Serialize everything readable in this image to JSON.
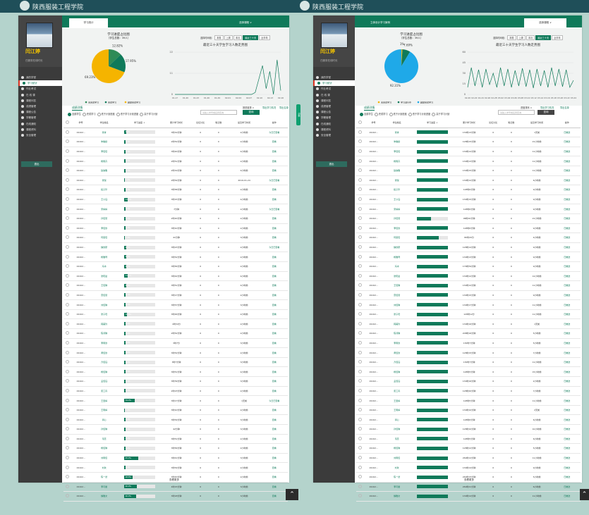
{
  "top_title": "陕西服装工程学院",
  "left": {
    "user_name": "闫江婷",
    "user_sub": "已服务在线时长",
    "menu": [
      "我的学堂",
      "学习统计",
      "作业考试",
      "在 线 课",
      "课程问答",
      "成绩管理",
      "课程公告",
      "学籍管理",
      "在线通知",
      "课程资料",
      "安全管理"
    ],
    "sidebar_button": "退出",
    "tab_active": "学习统计",
    "tab_dropdown": "选择课程 ∨",
    "pie_title": "学习进度占比图",
    "pie_sub": "（学生总数：39人）",
    "pie_labels": [
      "12.82%",
      "17.95%",
      "69.23%"
    ],
    "pie_legend": [
      "未完成学习",
      "完成学习",
      "超额完成学习"
    ],
    "filter_label": "选择时间段：",
    "filter_buttons": [
      "本周",
      "上周",
      "本月",
      "最近三十天",
      "近半年"
    ],
    "line_title": "最近三十天学生学习人数走势图",
    "y_ticks": [
      "22",
      "11",
      "0"
    ],
    "x_ticks": [
      "01-17",
      "01-20",
      "01-23",
      "01-26",
      "01-29",
      "02-01",
      "02-04",
      "02-07",
      "02-10",
      "02-13",
      "02-16"
    ],
    "section_title": "成绩详情",
    "sort_label": "按进度排 ∨",
    "export1": "导出学习情况",
    "export2": "导出名单",
    "radios": [
      "全部学生",
      "完成学习",
      "低于计划进度",
      "低于学习计划进度",
      "高于学习计划"
    ],
    "search_placeholder": "请输入学号或名称查询",
    "query_btn": "查询",
    "headers": [
      "学号",
      "学生姓名",
      "学习进度 ↓",
      "累计学习时长",
      "论坛讨论",
      "笔记数",
      "最近学习时间",
      "操作"
    ],
    "more": "查看更多"
  },
  "right": {
    "top_title": "陕西服装工程学院",
    "tab_active": "立体设计学习案例",
    "tab_dropdown": "选择课程 ∨",
    "pie_title": "学习进度占比图",
    "pie_sub": "（学生总数：39人）",
    "pie_labels": [
      "1%",
      "7.69%",
      "92.31%"
    ],
    "pie_legend": [
      "未完成学习",
      "学习进行中",
      "超额完成学习"
    ],
    "filter_label": "选择时间段：",
    "filter_buttons": [
      "本周",
      "上周",
      "本月",
      "最近三十天",
      "近半年"
    ],
    "line_title": "最近三十天学生学习人数走势图",
    "y_ticks": [
      "60",
      "45",
      "30",
      "15",
      "0"
    ],
    "x_ticks": [
      "02-20",
      "02-22",
      "02-24",
      "02-26",
      "02-28",
      "03-02",
      "03-04",
      "03-06",
      "03-08",
      "03-10",
      "03-12",
      "03-14",
      "03-16",
      "03-18",
      "03-20",
      "03-22",
      "03-24"
    ],
    "section_title": "成绩详情",
    "sort_label": "进度排序 ∨",
    "export1": "导出学习情况",
    "export2": "导出名单",
    "radios": [
      "全部学生",
      "完成学习",
      "低于计划进度",
      "低于学习计划进度",
      "高于学习计划"
    ],
    "search_placeholder": "请输入学号或名称查询",
    "query_btn": "查询",
    "headers": [
      "学号",
      "学生姓名",
      "学习进度 ↓",
      "累计学习时长",
      "论坛讨论",
      "笔记数",
      "最近学习时间",
      "操作"
    ],
    "more": "查看更多"
  },
  "left_rows": [
    {
      "id": "19102...",
      "name": "张青",
      "pct": "6.8%",
      "p": 0.068,
      "time": "3时19分钟",
      "f": "0",
      "n": "0",
      "last": "2小时前",
      "op": "今日已查看"
    },
    {
      "id": "19102...",
      "name": "朱敏婕",
      "pct": "4.4%",
      "p": 0.044,
      "time": "2时52分钟",
      "f": "0",
      "n": "0",
      "last": "2小时前",
      "op": "查看"
    },
    {
      "id": "19102...",
      "name": "李佳佳",
      "pct": "4.4%",
      "p": 0.044,
      "time": "3时20分钟",
      "f": "0",
      "n": "0",
      "last": "4小时前",
      "op": "查看"
    },
    {
      "id": "19102...",
      "name": "杨雨卉",
      "pct": "5.0%",
      "p": 0.05,
      "time": "2时51分钟",
      "f": "0",
      "n": "0",
      "last": "2小时前",
      "op": "查看"
    },
    {
      "id": "19102...",
      "name": "赵静雅",
      "pct": "4.3%",
      "p": 0.043,
      "time": "2时19分钟",
      "f": "0",
      "n": "0",
      "last": "4小时前",
      "op": "查看"
    },
    {
      "id": "19102...",
      "name": "张悦",
      "pct": "3.3%",
      "p": 0.033,
      "time": "2时54分钟",
      "f": "0",
      "n": "0",
      "last": "2019-01-24",
      "op": "今日已查看"
    },
    {
      "id": "19102...",
      "name": "段子珍",
      "pct": "5.3%",
      "p": 0.053,
      "time": "3时58分钟",
      "f": "0",
      "n": "0",
      "last": "2小时前",
      "op": "查看"
    },
    {
      "id": "19102...",
      "name": "王小钰",
      "pct": "12.2%",
      "p": 0.122,
      "time": "3时15分钟",
      "f": "0",
      "n": "0",
      "last": "4小时前",
      "op": "查看"
    },
    {
      "id": "19102...",
      "name": "宋婷婷",
      "pct": "5.3%",
      "p": 0.053,
      "time": "7分钟",
      "f": "0",
      "n": "0",
      "last": "2小时前",
      "op": "今日已查看"
    },
    {
      "id": "19102...",
      "name": "孙佳慧",
      "pct": "4.5%",
      "p": 0.045,
      "time": "2时20分钟",
      "f": "0",
      "n": "0",
      "last": "2小时前",
      "op": "查看"
    },
    {
      "id": "19102...",
      "name": "李佳欣",
      "pct": "4.3%",
      "p": 0.043,
      "time": "3时10分钟",
      "f": "0",
      "n": "0",
      "last": "2小时前",
      "op": "查看"
    },
    {
      "id": "19102...",
      "name": "何思佳",
      "pct": "3.4%",
      "p": 0.034,
      "time": "41分钟",
      "f": "0",
      "n": "0",
      "last": "3小时前",
      "op": "查看"
    },
    {
      "id": "19102...",
      "name": "魏欣研",
      "pct": "6.3%",
      "p": 0.063,
      "time": "3时23分钟",
      "f": "0",
      "n": "0",
      "last": "2小时前",
      "op": "今日已查看"
    },
    {
      "id": "19102...",
      "name": "杨雅琦",
      "pct": "6.3%",
      "p": 0.063,
      "time": "3时52分钟",
      "f": "0",
      "n": "0",
      "last": "2小时前",
      "op": "查看"
    },
    {
      "id": "19102...",
      "name": "冯冰",
      "pct": "6.7%",
      "p": 0.067,
      "time": "3时56分钟",
      "f": "0",
      "n": "0",
      "last": "2小时前",
      "op": "查看"
    },
    {
      "id": "19102...",
      "name": "张晓晨",
      "pct": "11.1%",
      "p": 0.111,
      "time": "3时42分钟",
      "f": "0",
      "n": "0",
      "last": "4小时前",
      "op": "查看"
    },
    {
      "id": "19102...",
      "name": "王佳琪",
      "pct": "8.3%",
      "p": 0.083,
      "time": "3时51分钟",
      "f": "0",
      "n": "0",
      "last": "4小时前",
      "op": "查看"
    },
    {
      "id": "19102...",
      "name": "雷佳慧",
      "pct": "5.1%",
      "p": 0.051,
      "time": "3时17分钟",
      "f": "0",
      "n": "0",
      "last": "2小时前",
      "op": "查看"
    },
    {
      "id": "19102...",
      "name": "刘佳琪",
      "pct": "4.4%",
      "p": 0.044,
      "time": "3时57分钟",
      "f": "0",
      "n": "0",
      "last": "3小时前",
      "op": "查看"
    },
    {
      "id": "19102...",
      "name": "张子旺",
      "pct": "10.0%",
      "p": 0.1,
      "time": "3时46分钟",
      "f": "0",
      "n": "0",
      "last": "2小时前",
      "op": "查看"
    },
    {
      "id": "19102...",
      "name": "韩美玲",
      "pct": "4.4%",
      "p": 0.044,
      "time": "4时34分",
      "f": "0",
      "n": "0",
      "last": "2小时前",
      "op": "查看"
    },
    {
      "id": "19102...",
      "name": "陈诗琪",
      "pct": "5.9%",
      "p": 0.059,
      "time": "2时52分钟",
      "f": "0",
      "n": "0",
      "last": "2小时前",
      "op": "查看"
    },
    {
      "id": "19102...",
      "name": "李雨欣",
      "pct": "4.9%",
      "p": 0.049,
      "time": "3时7分",
      "f": "0",
      "n": "0",
      "last": "3小时前",
      "op": "查看"
    },
    {
      "id": "19102...",
      "name": "黄佳欣",
      "pct": "5.8%",
      "p": 0.058,
      "time": "3时52分钟",
      "f": "0",
      "n": "0",
      "last": "2小时前",
      "op": "查看"
    },
    {
      "id": "19102...",
      "name": "齐佳钰",
      "pct": "6.0%",
      "p": 0.06,
      "time": "3时7分钟",
      "f": "0",
      "n": "0",
      "last": "3小时前",
      "op": "查看"
    },
    {
      "id": "19102...",
      "name": "杨佳琪",
      "pct": "4.5%",
      "p": 0.045,
      "time": "3时51分钟",
      "f": "0",
      "n": "0",
      "last": "4小时前",
      "op": "查看"
    },
    {
      "id": "19102...",
      "name": "孟佳钰",
      "pct": "4.4%",
      "p": 0.044,
      "time": "3时39分钟",
      "f": "0",
      "n": "0",
      "last": "3小时前",
      "op": "查看"
    },
    {
      "id": "19102...",
      "name": "唐工丹",
      "pct": "4.4%",
      "p": 0.044,
      "time": "2时23分钟",
      "f": "0",
      "n": "0",
      "last": "2小时前",
      "op": "查看"
    },
    {
      "id": "19102...",
      "name": "王雯婷",
      "pct": "34.0%",
      "p": 0.34,
      "time": "3时17分钟",
      "f": "0",
      "n": "0",
      "last": "1天前",
      "op": "今日已查看"
    },
    {
      "id": "19102...",
      "name": "王雨婷",
      "pct": "3.4%",
      "p": 0.034,
      "time": "3时10分钟",
      "f": "0",
      "n": "0",
      "last": "2小时前",
      "op": "查看"
    },
    {
      "id": "19102...",
      "name": "郭心",
      "pct": "4.4%",
      "p": 0.044,
      "time": "3时54分钟",
      "f": "0",
      "n": "0",
      "last": "3小时前",
      "op": "查看"
    },
    {
      "id": "19102...",
      "name": "孙佳琪",
      "pct": "4.4%",
      "p": 0.044,
      "time": "42分钟",
      "f": "0",
      "n": "0",
      "last": "3小时前",
      "op": "查看"
    },
    {
      "id": "19102...",
      "name": "韦蕊",
      "pct": "4.4%",
      "p": 0.044,
      "time": "3时51分钟",
      "f": "0",
      "n": "0",
      "last": "2小时前",
      "op": "查看"
    },
    {
      "id": "19102...",
      "name": "杨佳琪",
      "pct": "4.8%",
      "p": 0.048,
      "time": "3时56分钟",
      "f": "0",
      "n": "0",
      "last": "2小时前",
      "op": "查看"
    },
    {
      "id": "19102...",
      "name": "刘雨佳",
      "pct": "45.0%",
      "p": 0.45,
      "time": "3时41分钟",
      "f": "0",
      "n": "0",
      "last": "3小时前",
      "op": "查看"
    },
    {
      "id": "19102...",
      "name": "刘欢",
      "pct": "4.4%",
      "p": 0.044,
      "time": "3时54分钟",
      "f": "0",
      "n": "0",
      "last": "2小时前",
      "op": "查看"
    },
    {
      "id": "19102...",
      "name": "陈一然",
      "pct": "28.8%",
      "p": 0.288,
      "time": "3时20分钟",
      "f": "0",
      "n": "0",
      "last": "2小时前",
      "op": "查看"
    },
    {
      "id": "19102...",
      "name": "李可馨",
      "pct": "40.9%",
      "p": 0.409,
      "time": "4时15分钟",
      "f": "0",
      "n": "0",
      "last": "3小时前",
      "op": "查看"
    },
    {
      "id": "19102...",
      "name": "魏雅文",
      "pct": "40.0%",
      "p": 0.4,
      "time": "3时18分钟",
      "f": "0",
      "n": "0",
      "last": "3小时前",
      "op": "查看"
    }
  ],
  "right_rows": [
    {
      "id": "19102...",
      "name": "张青",
      "p": 1,
      "time": "130时13分钟",
      "f": "0",
      "n": "0",
      "last": "1天前",
      "op": "已推送"
    },
    {
      "id": "19102...",
      "name": "朱敏婕",
      "p": 1,
      "time": "128时15分钟",
      "f": "0",
      "n": "0",
      "last": "21小时前",
      "op": "已推送"
    },
    {
      "id": "19102...",
      "name": "李佳佳",
      "p": 1,
      "time": "130时12分钟",
      "f": "0",
      "n": "0",
      "last": "11小时前",
      "op": "已推送"
    },
    {
      "id": "19102...",
      "name": "杨雨卉",
      "p": 1,
      "time": "130时13分钟",
      "f": "0",
      "n": "0",
      "last": "11小时前",
      "op": "已推送"
    },
    {
      "id": "19102...",
      "name": "赵静雅",
      "p": 1,
      "time": "130时15分钟",
      "f": "0",
      "n": "0",
      "last": "11小时前",
      "op": "已推送"
    },
    {
      "id": "19102...",
      "name": "张悦",
      "p": 1,
      "time": "130时12分钟",
      "f": "0",
      "n": "0",
      "last": "6小时前",
      "op": "已推送"
    },
    {
      "id": "19102...",
      "name": "段子珍",
      "p": 1,
      "time": "128时6分钟",
      "f": "0",
      "n": "0",
      "last": "9小时前",
      "op": "已推送"
    },
    {
      "id": "19102...",
      "name": "王小钰",
      "p": 1,
      "time": "130时15分钟",
      "f": "0",
      "n": "0",
      "last": "9小时前",
      "op": "已推送"
    },
    {
      "id": "19102...",
      "name": "宋婷婷",
      "p": 1,
      "time": "128时6分钟",
      "f": "0",
      "n": "0",
      "last": "9小时前",
      "op": "已推送"
    },
    {
      "id": "19102...",
      "name": "孙佳慧",
      "p": 0.45,
      "time": "96时20分钟",
      "f": "0",
      "n": "0",
      "last": "21小时前",
      "op": "已推送"
    },
    {
      "id": "19102...",
      "name": "李佳欣",
      "p": 1,
      "time": "128时6分钟",
      "f": "0",
      "n": "0",
      "last": "9小时前",
      "op": "已推送"
    },
    {
      "id": "19102...",
      "name": "何思佳",
      "p": 0.7,
      "time": "80时20分",
      "f": "0",
      "n": "0",
      "last": "4小时前",
      "op": "已推送"
    },
    {
      "id": "19102...",
      "name": "魏欣研",
      "p": 1,
      "time": "128时14分钟",
      "f": "0",
      "n": "0",
      "last": "9小时前",
      "op": "已推送"
    },
    {
      "id": "19102...",
      "name": "杨雅琦",
      "p": 1,
      "time": "130时13分钟",
      "f": "0",
      "n": "0",
      "last": "9小时前",
      "op": "已推送"
    },
    {
      "id": "19102...",
      "name": "冯冰",
      "p": 1,
      "time": "176时59分钟",
      "f": "0",
      "n": "0",
      "last": "9小时前",
      "op": "已推送"
    },
    {
      "id": "19102...",
      "name": "张晓晨",
      "p": 1,
      "time": "130时12分钟",
      "f": "0",
      "n": "0",
      "last": "12小时前",
      "op": "已推送"
    },
    {
      "id": "19102...",
      "name": "王佳琪",
      "p": 1,
      "time": "130时12分钟",
      "f": "0",
      "n": "0",
      "last": "11小时前",
      "op": "已推送"
    },
    {
      "id": "19102...",
      "name": "雷佳慧",
      "p": 1,
      "time": "130时15分钟",
      "f": "0",
      "n": "0",
      "last": "9小时前",
      "op": "已推送"
    },
    {
      "id": "19102...",
      "name": "刘佳琪",
      "p": 1,
      "time": "130时17分钟",
      "f": "0",
      "n": "0",
      "last": "11小时前",
      "op": "已推送"
    },
    {
      "id": "19102...",
      "name": "张子旺",
      "p": 1,
      "time": "128时12分",
      "f": "0",
      "n": "0",
      "last": "11小时前",
      "op": "已推送"
    },
    {
      "id": "19102...",
      "name": "韩美玲",
      "p": 1,
      "time": "130时16分钟",
      "f": "0",
      "n": "0",
      "last": "1天前",
      "op": "已推送"
    },
    {
      "id": "19102...",
      "name": "陈诗琪",
      "p": 1,
      "time": "208时16分钟",
      "f": "0",
      "n": "0",
      "last": "5小时前",
      "op": "已推送"
    },
    {
      "id": "19102...",
      "name": "李雨欣",
      "p": 1,
      "time": "130时7分钟",
      "f": "0",
      "n": "0",
      "last": "5小时前",
      "op": "已推送"
    },
    {
      "id": "19102...",
      "name": "黄佳欣",
      "p": 1,
      "time": "128时15分钟",
      "f": "0",
      "n": "0",
      "last": "7小时前",
      "op": "已推送"
    },
    {
      "id": "19102...",
      "name": "齐佳钰",
      "p": 1,
      "time": "130时7分钟",
      "f": "0",
      "n": "0",
      "last": "11小时前",
      "op": "已推送"
    },
    {
      "id": "19102...",
      "name": "杨佳琪",
      "p": 1,
      "time": "128时5分钟",
      "f": "0",
      "n": "0",
      "last": "15小时前",
      "op": "已推送"
    },
    {
      "id": "19102...",
      "name": "孟佳钰",
      "p": 1,
      "time": "130时16分钟",
      "f": "0",
      "n": "0",
      "last": "2小时前",
      "op": "已推送"
    },
    {
      "id": "19102...",
      "name": "唐工丹",
      "p": 1,
      "time": "128时20分钟",
      "f": "0",
      "n": "0",
      "last": "7小时前",
      "op": "已推送"
    },
    {
      "id": "19102...",
      "name": "王雯婷",
      "p": 1,
      "time": "128时5分钟",
      "f": "0",
      "n": "0",
      "last": "11小时前",
      "op": "已推送"
    },
    {
      "id": "19102...",
      "name": "王雨婷",
      "p": 1,
      "time": "130时10分钟",
      "f": "0",
      "n": "0",
      "last": "2天前",
      "op": "已推送"
    },
    {
      "id": "19102...",
      "name": "郭心",
      "p": 1,
      "time": "128时6分钟",
      "f": "0",
      "n": "0",
      "last": "6小时前",
      "op": "已推送"
    },
    {
      "id": "19102...",
      "name": "孙佳琪",
      "p": 1,
      "time": "128时10分钟",
      "f": "0",
      "n": "0",
      "last": "10小时前",
      "op": "已推送"
    },
    {
      "id": "19102...",
      "name": "韦蕊",
      "p": 1,
      "time": "128时5分钟",
      "f": "0",
      "n": "0",
      "last": "6小时前",
      "op": "已推送"
    },
    {
      "id": "19102...",
      "name": "杨佳琪",
      "p": 1,
      "time": "128时12分钟",
      "f": "0",
      "n": "0",
      "last": "5小时前",
      "op": "已推送"
    },
    {
      "id": "19102...",
      "name": "刘雨佳",
      "p": 1,
      "time": "260时12分钟",
      "f": "0",
      "n": "0",
      "last": "11小时前",
      "op": "已推送"
    },
    {
      "id": "19102...",
      "name": "刘欢",
      "p": 1,
      "time": "130时14分钟",
      "f": "0",
      "n": "0",
      "last": "9小时前",
      "op": "已推送"
    },
    {
      "id": "19102...",
      "name": "陈一然",
      "p": 1,
      "time": "260时15分钟",
      "f": "0",
      "n": "0",
      "last": "5小时前",
      "op": "已推送"
    },
    {
      "id": "19102...",
      "name": "李可馨",
      "p": 1,
      "time": "260时21分钟",
      "f": "0",
      "n": "0",
      "last": "6小时前",
      "op": "已推送"
    },
    {
      "id": "19102...",
      "name": "魏雅文",
      "p": 1,
      "time": "130时14分钟",
      "f": "0",
      "n": "0",
      "last": "11小时前",
      "op": "已推送"
    }
  ],
  "chart_data": [
    {
      "type": "pie",
      "values": [
        12.82,
        17.95,
        69.23
      ],
      "labels": [
        "12.82%",
        "17.95%",
        "69.23%"
      ],
      "colors": [
        "#2e8b57",
        "#0f7a5a",
        "#f5b400"
      ]
    },
    {
      "type": "line",
      "ylim": [
        0,
        22
      ],
      "values": [
        0,
        0,
        0,
        0,
        0,
        0,
        0,
        0,
        0,
        0,
        0,
        0,
        0,
        0,
        0,
        0,
        0,
        0,
        0,
        0,
        0,
        0,
        1,
        8,
        15,
        3,
        12,
        0,
        18,
        2
      ]
    },
    {
      "type": "pie",
      "values": [
        1,
        7.69,
        92.31
      ],
      "labels": [
        "1%",
        "7.69%",
        "92.31%"
      ],
      "colors": [
        "#f5b400",
        "#0f7a5a",
        "#1fa9e8"
      ]
    },
    {
      "type": "line",
      "ylim": [
        0,
        60
      ],
      "values": [
        10,
        38,
        12,
        35,
        10,
        36,
        14,
        30,
        10,
        38,
        12,
        36,
        10,
        34,
        12,
        37,
        11,
        35,
        9,
        36,
        12,
        34,
        10,
        38,
        12,
        36,
        11,
        35,
        10,
        20
      ]
    }
  ]
}
